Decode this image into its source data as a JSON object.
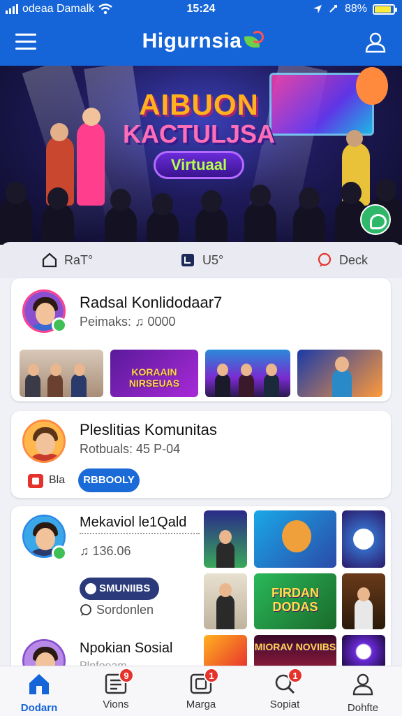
{
  "status_bar": {
    "carrier": "odeaa Damalk",
    "time": "15:24",
    "battery": "88%",
    "battery_level": 0.88
  },
  "header": {
    "title": "Higurnsia"
  },
  "hero": {
    "title_line1": "AIBUON",
    "title_line2": "KACTULJSA",
    "title_line3": "Virtuaal"
  },
  "tabs": [
    {
      "label": "RaT°"
    },
    {
      "label": "U5°"
    },
    {
      "label": "Deck"
    }
  ],
  "cards": [
    {
      "name": "Radsal Konlidodaar7",
      "meta": "Peimaks: ♫ 0000",
      "thumbnails": [
        {
          "label": ""
        },
        {
          "label": "KORAAIN NIRSEUAS"
        },
        {
          "label": ""
        },
        {
          "label": ""
        }
      ]
    },
    {
      "name": "Pleslitias Komunitas",
      "meta": "Rotbuals: 45 P-04",
      "tag": "Bla",
      "action_label": "RBBOOLY"
    },
    {
      "name": "Mekaviol le1Qald",
      "meta": "♫ 136.06",
      "pill_label": "SMUNIIBS",
      "comment_label": "Sordonlen",
      "grid": [
        {
          "label": ""
        },
        {
          "label": ""
        },
        {
          "label": ""
        },
        {
          "label": ""
        },
        {
          "label": "FIRDAN DODAS"
        },
        {
          "label": ""
        },
        {
          "label": ""
        },
        {
          "label": "MIORAV NOVIIBS"
        },
        {
          "label": ""
        }
      ]
    },
    {
      "name": "Npokian Sosial",
      "meta": "Plnfoeam"
    }
  ],
  "bottom_nav": [
    {
      "label": "Dodarn",
      "badge": "",
      "active": true
    },
    {
      "label": "Vions",
      "badge": "9"
    },
    {
      "label": "Marga",
      "badge": "1"
    },
    {
      "label": "Sopiat",
      "badge": "1"
    },
    {
      "label": "Dohfte",
      "badge": ""
    }
  ],
  "colors": {
    "primary": "#1565d8",
    "online": "#3fbf55",
    "badge": "#e5322d",
    "avatar_ring": "#ff3f8e"
  }
}
